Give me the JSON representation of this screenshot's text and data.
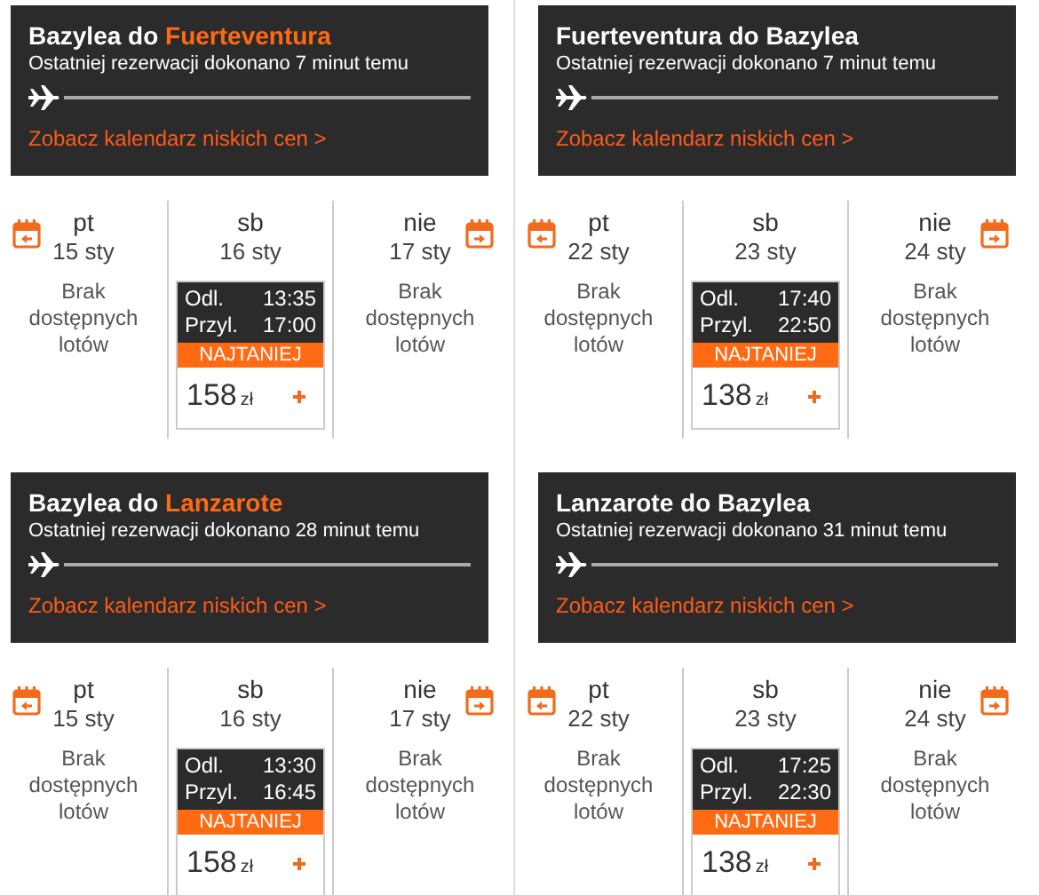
{
  "routes": [
    {
      "title": [
        {
          "text": "Bazylea do ",
          "highlighted": false
        },
        {
          "text": "Fuerteventura",
          "highlighted": true
        }
      ],
      "last_booking": "Ostatniej rezerwacji dokonano 7 minut temu",
      "calendar_link": "Zobacz kalendarz niskich cen >",
      "days": [
        {
          "weekday": "pt",
          "date": "15 sty",
          "kind": "none",
          "message": "Brak dostępnych lotów"
        },
        {
          "weekday": "sb",
          "date": "16 sty",
          "kind": "flight",
          "depart_label": "Odl.",
          "depart_time": "13:35",
          "arrive_label": "Przyl.",
          "arrive_time": "17:00",
          "badge": "NAJTANIEJ",
          "price": "158",
          "currency": "zł"
        },
        {
          "weekday": "nie",
          "date": "17 sty",
          "kind": "none",
          "message": "Brak dostępnych lotów"
        }
      ]
    },
    {
      "title": [
        {
          "text": "Fuerteventura do Bazylea",
          "highlighted": false
        }
      ],
      "last_booking": "Ostatniej rezerwacji dokonano 7 minut temu",
      "calendar_link": "Zobacz kalendarz niskich cen >",
      "days": [
        {
          "weekday": "pt",
          "date": "22 sty",
          "kind": "none",
          "message": "Brak dostępnych lotów"
        },
        {
          "weekday": "sb",
          "date": "23 sty",
          "kind": "flight",
          "depart_label": "Odl.",
          "depart_time": "17:40",
          "arrive_label": "Przyl.",
          "arrive_time": "22:50",
          "badge": "NAJTANIEJ",
          "price": "138",
          "currency": "zł"
        },
        {
          "weekday": "nie",
          "date": "24 sty",
          "kind": "none",
          "message": "Brak dostępnych lotów"
        }
      ]
    },
    {
      "title": [
        {
          "text": "Bazylea do ",
          "highlighted": false
        },
        {
          "text": "Lanzarote",
          "highlighted": true
        }
      ],
      "last_booking": "Ostatniej rezerwacji dokonano 28 minut temu",
      "calendar_link": "Zobacz kalendarz niskich cen >",
      "days": [
        {
          "weekday": "pt",
          "date": "15 sty",
          "kind": "none",
          "message": "Brak dostępnych lotów"
        },
        {
          "weekday": "sb",
          "date": "16 sty",
          "kind": "flight",
          "depart_label": "Odl.",
          "depart_time": "13:30",
          "arrive_label": "Przyl.",
          "arrive_time": "16:45",
          "badge": "NAJTANIEJ",
          "price": "158",
          "currency": "zł"
        },
        {
          "weekday": "nie",
          "date": "17 sty",
          "kind": "none",
          "message": "Brak dostępnych lotów"
        }
      ]
    },
    {
      "title": [
        {
          "text": "Lanzarote do Bazylea",
          "highlighted": false
        }
      ],
      "last_booking": "Ostatniej rezerwacji dokonano 31 minut temu",
      "calendar_link": "Zobacz kalendarz niskich cen >",
      "days": [
        {
          "weekday": "pt",
          "date": "22 sty",
          "kind": "none",
          "message": "Brak dostępnych lotów"
        },
        {
          "weekday": "sb",
          "date": "23 sty",
          "kind": "flight",
          "depart_label": "Odl.",
          "depart_time": "17:25",
          "arrive_label": "Przyl.",
          "arrive_time": "22:30",
          "badge": "NAJTANIEJ",
          "price": "138",
          "currency": "zł"
        },
        {
          "weekday": "nie",
          "date": "24 sty",
          "kind": "none",
          "message": "Brak dostępnych lotów"
        }
      ]
    }
  ]
}
